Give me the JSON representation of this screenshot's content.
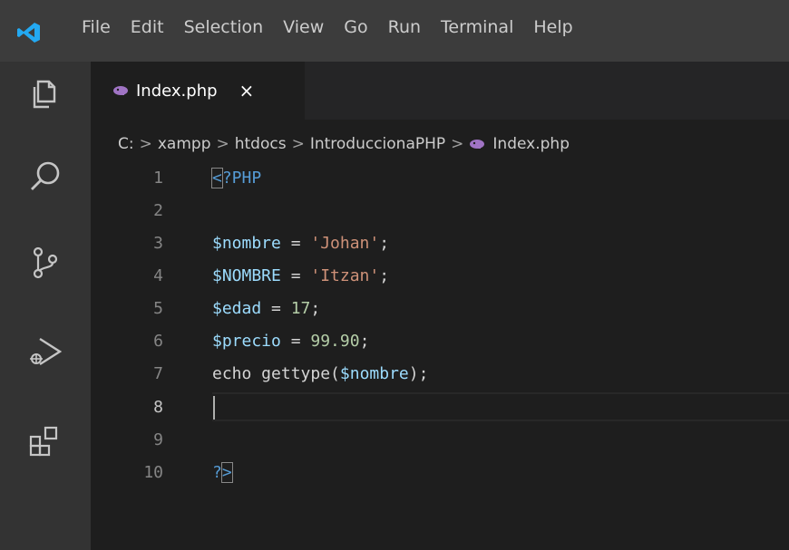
{
  "menu": [
    "File",
    "Edit",
    "Selection",
    "View",
    "Go",
    "Run",
    "Terminal",
    "Help"
  ],
  "tab": {
    "name": "Index.php",
    "close": "×"
  },
  "breadcrumb": [
    "C:",
    "xampp",
    "htdocs",
    "IntroduccionaPHP",
    "Index.php"
  ],
  "breadcrumb_sep": ">",
  "line_numbers": [
    "1",
    "2",
    "3",
    "4",
    "5",
    "6",
    "7",
    "8",
    "9",
    "10"
  ],
  "code": {
    "l1_open": "<",
    "l1_rest": "?PHP",
    "l3_var": "$nombre",
    "l3_eq": " = ",
    "l3_str": "'Johan'",
    "l3_semi": ";",
    "l4_var": "$NOMBRE",
    "l4_eq": " = ",
    "l4_str": "'Itzan'",
    "l4_semi": ";",
    "l5_var": "$edad",
    "l5_eq": " = ",
    "l5_num": "17",
    "l5_semi": ";",
    "l6_var": "$precio",
    "l6_eq": " = ",
    "l6_num": "99.90",
    "l6_semi": ";",
    "l7_kw": "echo gettype(",
    "l7_var": "$nombre",
    "l7_end": ");",
    "l10_q": "?",
    "l10_close": ">"
  },
  "colors": {
    "titlebar": "#3c3c3c",
    "activitybar": "#333333",
    "editor": "#1e1e1e",
    "variable": "#9cdcfe",
    "string": "#ce9178",
    "number": "#b5cea8",
    "tag": "#569cd6",
    "vscode_logo": "#23a9f2",
    "php_icon": "#a074c4"
  },
  "icons": [
    "vscode-logo",
    "explorer-icon",
    "search-icon",
    "source-control-icon",
    "run-debug-icon",
    "extensions-icon",
    "php-file-icon"
  ]
}
